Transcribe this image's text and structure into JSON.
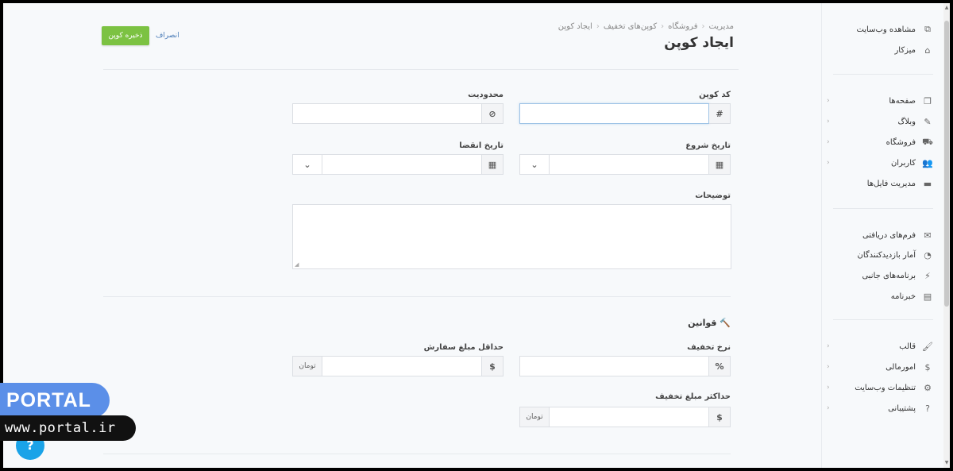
{
  "header": {
    "breadcrumb": [
      "مدیریت",
      "فروشگاه",
      "کوپن‌های تخفیف",
      "ایجاد کوپن"
    ],
    "title": "ایجاد کوپن",
    "save_label": "ذخیره کوپن",
    "cancel_label": "انصراف"
  },
  "form": {
    "coupon_code": {
      "label": "کد کوپن",
      "addon": "#",
      "value": ""
    },
    "limit": {
      "label": "محدودیت",
      "addon": "⊘",
      "value": ""
    },
    "start_date": {
      "label": "تاریخ شروع",
      "value": ""
    },
    "end_date": {
      "label": "تاریخ انقضا",
      "value": ""
    },
    "description": {
      "label": "توضیحات",
      "value": ""
    },
    "rules_title": "قوانین",
    "discount_rate": {
      "label": "نرخ تخفیف",
      "addon": "%",
      "value": ""
    },
    "min_order": {
      "label": "حداقل مبلغ سفارش",
      "currency_symbol": "$",
      "unit": "تومان",
      "value": ""
    },
    "max_discount": {
      "label": "حداکثر مبلغ تخفیف",
      "currency_symbol": "$",
      "unit": "تومان",
      "value": ""
    }
  },
  "sidebar": {
    "items": [
      {
        "label": "مشاهده وب‌سایت",
        "icon": "external-link-icon",
        "glyph": "⧉"
      },
      {
        "label": "میزکار",
        "icon": "home-icon",
        "glyph": "⌂"
      },
      {
        "label": "صفحه‌ها",
        "icon": "pages-icon",
        "glyph": "❐",
        "chevron": "‹"
      },
      {
        "label": "وبلاگ",
        "icon": "pencil-icon",
        "glyph": "✎",
        "chevron": "‹"
      },
      {
        "label": "فروشگاه",
        "icon": "cart-icon",
        "glyph": "⛟",
        "chevron": "‹"
      },
      {
        "label": "کاربران",
        "icon": "users-icon",
        "glyph": "👥",
        "chevron": "‹"
      },
      {
        "label": "مدیریت فایل‌ها",
        "icon": "folder-icon",
        "glyph": "▬"
      },
      {
        "label": "فرم‌های دریافتی",
        "icon": "envelope-icon",
        "glyph": "✉"
      },
      {
        "label": "آمار بازدیدکنندگان",
        "icon": "pie-chart-icon",
        "glyph": "◔"
      },
      {
        "label": "برنامه‌های جانبی",
        "icon": "plug-icon",
        "glyph": "⚡"
      },
      {
        "label": "خبرنامه",
        "icon": "newspaper-icon",
        "glyph": "▤"
      },
      {
        "label": "قالب",
        "icon": "brush-icon",
        "glyph": "🖌",
        "chevron": "‹"
      },
      {
        "label": "امورمالی",
        "icon": "dollar-icon",
        "glyph": "$",
        "chevron": "‹"
      },
      {
        "label": "تنظیمات وب‌سایت",
        "icon": "gear-icon",
        "glyph": "⚙",
        "chevron": "‹"
      },
      {
        "label": "پشتیبانی",
        "icon": "question-icon",
        "glyph": "?",
        "chevron": "‹"
      }
    ]
  },
  "watermark": {
    "brand": "PORTAL",
    "url": "www.portal.ir",
    "help_glyph": "?"
  },
  "colors": {
    "save_button": "#7cc242",
    "cancel_link": "#4a7bb7",
    "watermark_blue": "#5b8fe8",
    "help_blue": "#1aa3e8"
  }
}
